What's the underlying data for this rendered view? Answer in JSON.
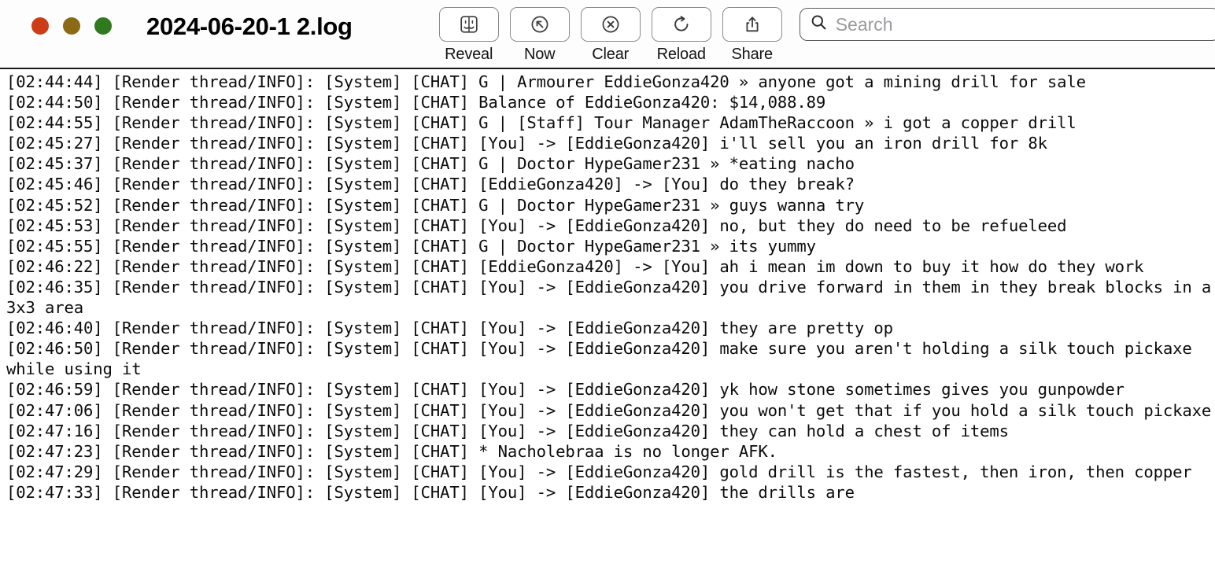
{
  "window": {
    "title": "2024-06-20-1 2.log",
    "traffic_lights": [
      {
        "name": "close",
        "color": "#cc3c16"
      },
      {
        "name": "minimize",
        "color": "#8a6a14"
      },
      {
        "name": "zoom",
        "color": "#2f7a1e"
      }
    ]
  },
  "toolbar": {
    "buttons": [
      {
        "label": "Reveal",
        "icon": "finder-icon"
      },
      {
        "label": "Now",
        "icon": "arrow-up-left-circle-icon"
      },
      {
        "label": "Clear",
        "icon": "x-circle-icon"
      },
      {
        "label": "Reload",
        "icon": "reload-icon"
      },
      {
        "label": "Share",
        "icon": "share-icon"
      }
    ]
  },
  "search": {
    "placeholder": "Search",
    "value": "",
    "icon": "search-icon"
  },
  "log": {
    "lines": [
      "[02:44:44] [Render thread/INFO]: [System] [CHAT] G | Armourer EddieGonza420 » anyone got a mining drill for sale",
      "[02:44:50] [Render thread/INFO]: [System] [CHAT] Balance of EddieGonza420: $14,088.89",
      "[02:44:55] [Render thread/INFO]: [System] [CHAT] G | [Staff] Tour Manager AdamTheRaccoon » i got a copper drill",
      "[02:45:27] [Render thread/INFO]: [System] [CHAT] [You] -> [EddieGonza420] i'll sell you an iron drill for 8k",
      "[02:45:37] [Render thread/INFO]: [System] [CHAT] G | Doctor HypeGamer231 » *eating nacho",
      "[02:45:46] [Render thread/INFO]: [System] [CHAT] [EddieGonza420] -> [You] do they break?",
      "[02:45:52] [Render thread/INFO]: [System] [CHAT] G | Doctor HypeGamer231 » guys wanna try",
      "[02:45:53] [Render thread/INFO]: [System] [CHAT] [You] -> [EddieGonza420] no, but they do need to be refueleed",
      "[02:45:55] [Render thread/INFO]: [System] [CHAT] G | Doctor HypeGamer231 » its yummy",
      "[02:46:22] [Render thread/INFO]: [System] [CHAT] [EddieGonza420] -> [You] ah i mean im down to buy it how do they work",
      "[02:46:35] [Render thread/INFO]: [System] [CHAT] [You] -> [EddieGonza420] you drive forward in them in they break blocks in a 3x3 area",
      "[02:46:40] [Render thread/INFO]: [System] [CHAT] [You] -> [EddieGonza420] they are pretty op",
      "[02:46:50] [Render thread/INFO]: [System] [CHAT] [You] -> [EddieGonza420] make sure you aren't holding a silk touch pickaxe while using it",
      "[02:46:59] [Render thread/INFO]: [System] [CHAT] [You] -> [EddieGonza420] yk how stone sometimes gives you gunpowder",
      "[02:47:06] [Render thread/INFO]: [System] [CHAT] [You] -> [EddieGonza420] you won't get that if you hold a silk touch pickaxe",
      "[02:47:16] [Render thread/INFO]: [System] [CHAT] [You] -> [EddieGonza420] they can hold a chest of items",
      "[02:47:23] [Render thread/INFO]: [System] [CHAT] * Nacholebraa is no longer AFK.",
      "[02:47:29] [Render thread/INFO]: [System] [CHAT] [You] -> [EddieGonza420] gold drill is the fastest, then iron, then copper",
      "[02:47:33] [Render thread/INFO]: [System] [CHAT] [You] -> [EddieGonza420] the drills are"
    ]
  }
}
